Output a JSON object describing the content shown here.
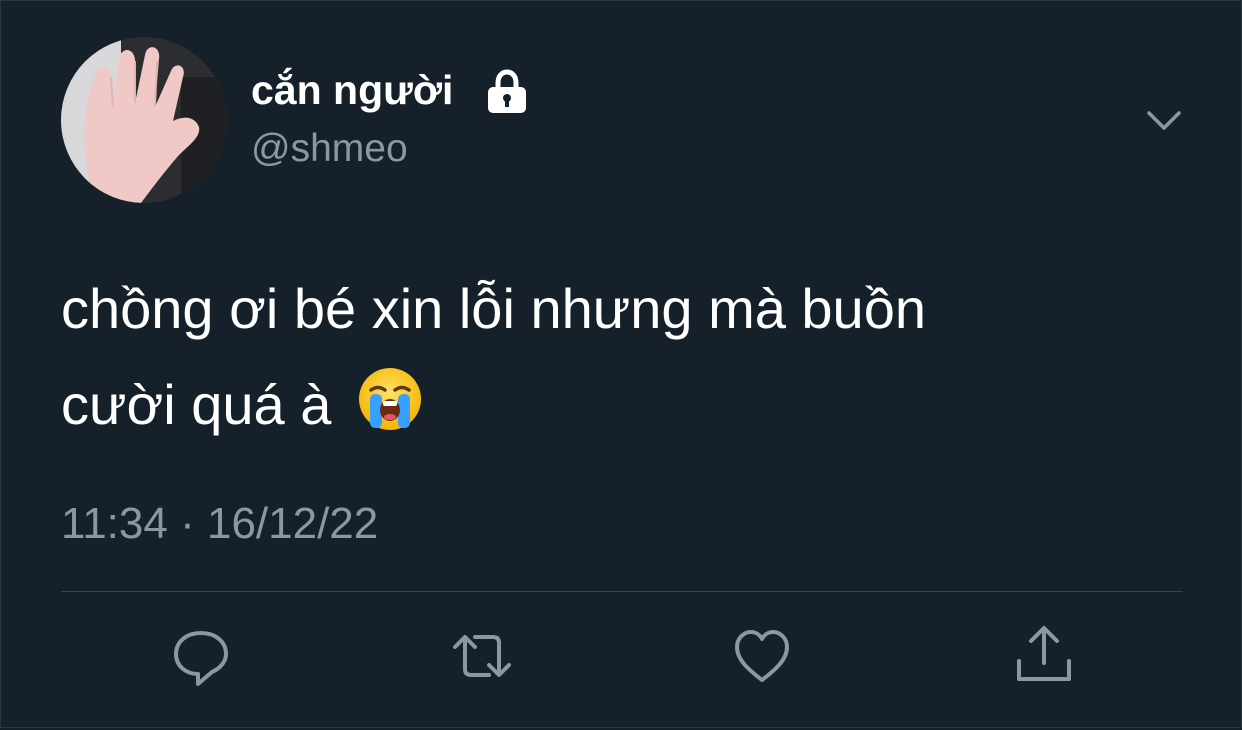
{
  "tweet": {
    "display_name": "cắn người",
    "handle": "@shmeo",
    "is_protected": true,
    "text_line_1": "chồng ơi bé xin lỗi nhưng mà buồn",
    "text_line_2": "cười quá à",
    "emoji": "loudly-crying-face-emoji",
    "time": "11:34",
    "separator": "·",
    "date": "16/12/22"
  },
  "icons": {
    "lock": "lock-icon",
    "menu": "chevron-down-icon",
    "reply": "reply-icon",
    "retweet": "retweet-icon",
    "like": "heart-icon",
    "share": "share-icon"
  },
  "colors": {
    "background": "#15202b",
    "text_primary": "#ffffff",
    "text_secondary": "#8899a6",
    "divider": "#38444d"
  }
}
